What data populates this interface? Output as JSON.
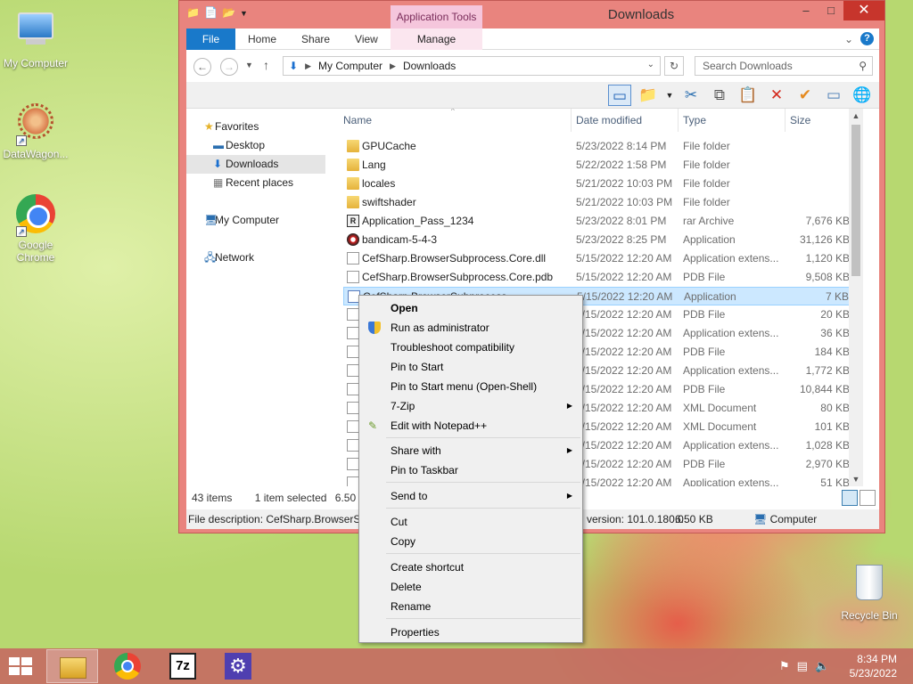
{
  "desktop": {
    "icons": [
      {
        "label": "My Computer",
        "icon": "computer-icon"
      },
      {
        "label": "DataWagon...",
        "icon": "datawagon-icon"
      },
      {
        "label": "Google Chrome",
        "icon": "chrome-icon"
      },
      {
        "label": "Recycle Bin",
        "icon": "recycle-bin-icon"
      }
    ]
  },
  "window": {
    "title": "Downloads",
    "app_tools_label": "Application Tools",
    "controls": {
      "minimize": "–",
      "maximize": "□",
      "close": "✕"
    },
    "ribbon": {
      "file": "File",
      "tabs": [
        "Home",
        "Share",
        "View"
      ],
      "manage": "Manage",
      "expand": "⌄",
      "help": "?"
    },
    "address": {
      "crumbs": [
        "My Computer",
        "Downloads"
      ],
      "search_placeholder": "Search Downloads"
    },
    "nav_pane": {
      "items": [
        {
          "label": "Favorites",
          "icon": "star-icon"
        },
        {
          "label": "Desktop",
          "icon": "desktop-icon"
        },
        {
          "label": "Downloads",
          "icon": "downloads-icon"
        },
        {
          "label": "Recent places",
          "icon": "recent-places-icon"
        },
        {
          "label": "My Computer",
          "icon": "computer-icon"
        },
        {
          "label": "Network",
          "icon": "network-icon"
        }
      ]
    },
    "columns": {
      "name": "Name",
      "date": "Date modified",
      "type": "Type",
      "size": "Size"
    },
    "files": [
      {
        "name": "GPUCache",
        "date": "5/23/2022 8:14 PM",
        "type": "File folder",
        "size": "",
        "icon": "folder"
      },
      {
        "name": "Lang",
        "date": "5/22/2022 1:58 PM",
        "type": "File folder",
        "size": "",
        "icon": "folder"
      },
      {
        "name": "locales",
        "date": "5/21/2022 10:03 PM",
        "type": "File folder",
        "size": "",
        "icon": "folder"
      },
      {
        "name": "swiftshader",
        "date": "5/21/2022 10:03 PM",
        "type": "File folder",
        "size": "",
        "icon": "folder"
      },
      {
        "name": "Application_Pass_1234",
        "date": "5/23/2022 8:01 PM",
        "type": "rar Archive",
        "size": "7,676 KB",
        "icon": "rar"
      },
      {
        "name": "bandicam-5-4-3",
        "date": "5/23/2022 8:25 PM",
        "type": "Application",
        "size": "31,126 KB",
        "icon": "bandicam"
      },
      {
        "name": "CefSharp.BrowserSubprocess.Core.dll",
        "date": "5/15/2022 12:20 AM",
        "type": "Application extens...",
        "size": "1,120 KB",
        "icon": "dll"
      },
      {
        "name": "CefSharp.BrowserSubprocess.Core.pdb",
        "date": "5/15/2022 12:20 AM",
        "type": "PDB File",
        "size": "9,508 KB",
        "icon": "doc"
      },
      {
        "name": "CefSharp.BrowserSubprocess",
        "date": "5/15/2022 12:20 AM",
        "type": "Application",
        "size": "7 KB",
        "icon": "app"
      },
      {
        "name": "",
        "date": "5/15/2022 12:20 AM",
        "type": "PDB File",
        "size": "20 KB",
        "icon": "doc"
      },
      {
        "name": "",
        "date": "5/15/2022 12:20 AM",
        "type": "Application extens...",
        "size": "36 KB",
        "icon": "dll"
      },
      {
        "name": "",
        "date": "5/15/2022 12:20 AM",
        "type": "PDB File",
        "size": "184 KB",
        "icon": "doc"
      },
      {
        "name": "",
        "date": "5/15/2022 12:20 AM",
        "type": "Application extens...",
        "size": "1,772 KB",
        "icon": "dll"
      },
      {
        "name": "",
        "date": "5/15/2022 12:20 AM",
        "type": "PDB File",
        "size": "10,844 KB",
        "icon": "doc"
      },
      {
        "name": "",
        "date": "5/15/2022 12:20 AM",
        "type": "XML Document",
        "size": "80 KB",
        "icon": "doc"
      },
      {
        "name": "",
        "date": "5/15/2022 12:20 AM",
        "type": "XML Document",
        "size": "101 KB",
        "icon": "doc"
      },
      {
        "name": "",
        "date": "5/15/2022 12:20 AM",
        "type": "Application extens...",
        "size": "1,028 KB",
        "icon": "dll"
      },
      {
        "name": "",
        "date": "5/15/2022 12:20 AM",
        "type": "PDB File",
        "size": "2,970 KB",
        "icon": "doc"
      },
      {
        "name": "",
        "date": "5/15/2022 12:20 AM",
        "type": "Application extens...",
        "size": "51 KB",
        "icon": "dll"
      }
    ],
    "status": {
      "count": "43 items",
      "selected": "1 item selected",
      "selected_size": "6.50 KB"
    },
    "details": {
      "description": "File description: CefSharp.BrowserSubprocess",
      "version": "version: 101.0.180.0",
      "size": "6.50 KB",
      "location": "Computer"
    }
  },
  "context_menu": {
    "items": [
      {
        "label": "Open",
        "bold": true
      },
      {
        "label": "Run as administrator",
        "icon": "shield-icon"
      },
      {
        "label": "Troubleshoot compatibility"
      },
      {
        "label": "Pin to Start"
      },
      {
        "label": "Pin to Start menu (Open-Shell)"
      },
      {
        "label": "7-Zip",
        "submenu": true
      },
      {
        "label": "Edit with Notepad++",
        "icon": "notepad-icon"
      },
      {
        "label": "Share with",
        "submenu": true
      },
      {
        "label": "Pin to Taskbar"
      },
      {
        "label": "Send to",
        "submenu": true
      },
      {
        "label": "Cut"
      },
      {
        "label": "Copy"
      },
      {
        "label": "Create shortcut"
      },
      {
        "label": "Delete"
      },
      {
        "label": "Rename"
      },
      {
        "label": "Properties"
      }
    ]
  },
  "taskbar": {
    "apps": [
      "file-explorer-icon",
      "chrome-icon",
      "7zip-icon",
      "settings-icon"
    ],
    "clock_time": "8:34 PM",
    "clock_date": "5/23/2022",
    "sevenzip_label": "7z"
  }
}
